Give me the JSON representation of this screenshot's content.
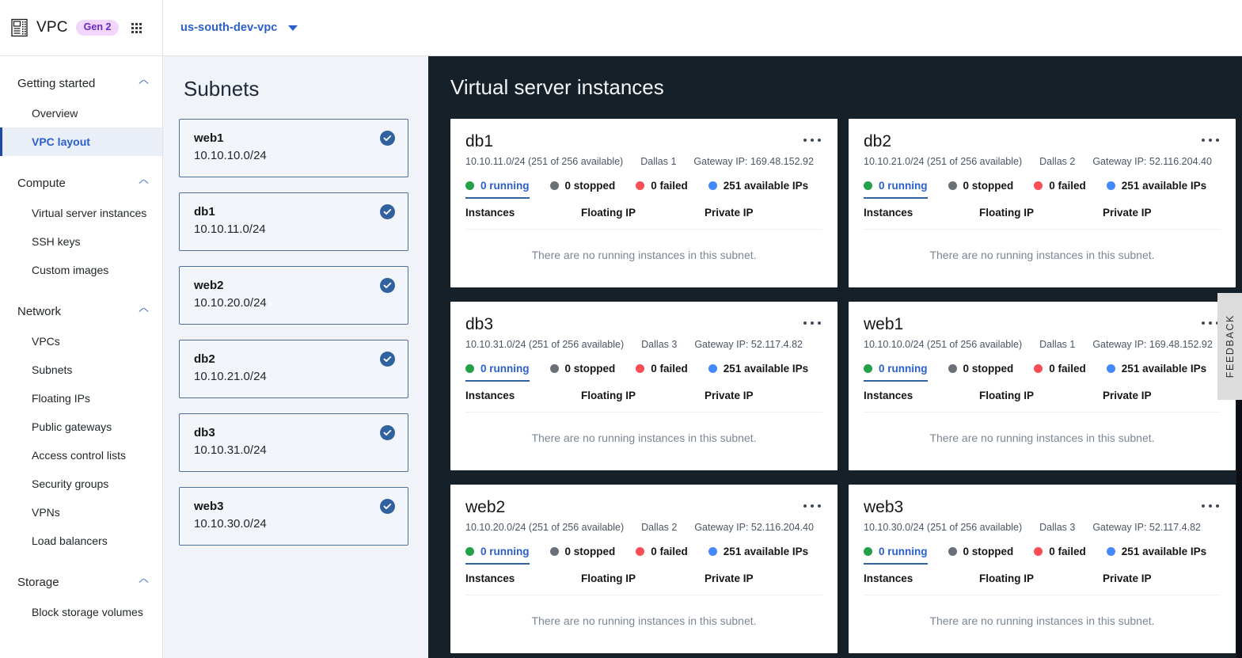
{
  "header": {
    "logo_icon": "server-rack-icon",
    "brand": "VPC",
    "gen_badge": "Gen 2",
    "app_switcher_icon": "grid-dots-icon",
    "vpc_selector": {
      "value": "us-south-dev-vpc",
      "caret_icon": "chevron-down-icon"
    }
  },
  "sidebar": {
    "groups": [
      {
        "title": "Getting started",
        "chevron_icon": "chevron-up-icon",
        "items": [
          {
            "label": "Overview",
            "active": false
          },
          {
            "label": "VPC layout",
            "active": true
          }
        ]
      },
      {
        "title": "Compute",
        "chevron_icon": "chevron-up-icon",
        "items": [
          {
            "label": "Virtual server instances",
            "active": false
          },
          {
            "label": "SSH keys",
            "active": false
          },
          {
            "label": "Custom images",
            "active": false
          }
        ]
      },
      {
        "title": "Network",
        "chevron_icon": "chevron-up-icon",
        "items": [
          {
            "label": "VPCs",
            "active": false
          },
          {
            "label": "Subnets",
            "active": false
          },
          {
            "label": "Floating IPs",
            "active": false
          },
          {
            "label": "Public gateways",
            "active": false
          },
          {
            "label": "Access control lists",
            "active": false
          },
          {
            "label": "Security groups",
            "active": false
          },
          {
            "label": "VPNs",
            "active": false
          },
          {
            "label": "Load balancers",
            "active": false
          }
        ]
      },
      {
        "title": "Storage",
        "chevron_icon": "chevron-up-icon",
        "items": [
          {
            "label": "Block storage volumes",
            "active": false
          }
        ]
      }
    ]
  },
  "subnets_panel": {
    "title": "Subnets",
    "check_icon": "check-circle-icon",
    "items": [
      {
        "name": "web1",
        "cidr": "10.10.10.0/24",
        "selected": true
      },
      {
        "name": "db1",
        "cidr": "10.10.11.0/24",
        "selected": true
      },
      {
        "name": "web2",
        "cidr": "10.10.20.0/24",
        "selected": true
      },
      {
        "name": "db2",
        "cidr": "10.10.21.0/24",
        "selected": true
      },
      {
        "name": "db3",
        "cidr": "10.10.31.0/24",
        "selected": true
      },
      {
        "name": "web3",
        "cidr": "10.10.30.0/24",
        "selected": true
      }
    ]
  },
  "instances_panel": {
    "title": "Virtual server instances",
    "kebab_icon": "overflow-menu-icon",
    "table_headers": [
      "Instances",
      "Floating IP",
      "Private IP"
    ],
    "empty_message": "There are no running instances in this subnet.",
    "status_colors": {
      "running": "#24a148",
      "stopped": "#697077",
      "failed": "#fa4d56",
      "available": "#4589ff",
      "link": "#2b5fce"
    },
    "cards": [
      {
        "name": "db1",
        "cidr": "10.10.11.0/24 (251 of 256 available)",
        "zone": "Dallas 1",
        "gateway": "Gateway IP: 169.48.152.92",
        "stats": [
          {
            "label": "0 running",
            "kind": "running"
          },
          {
            "label": "0 stopped",
            "kind": "stopped"
          },
          {
            "label": "0 failed",
            "kind": "failed"
          },
          {
            "label": "251 available IPs",
            "kind": "available"
          }
        ]
      },
      {
        "name": "db2",
        "cidr": "10.10.21.0/24 (251 of 256 available)",
        "zone": "Dallas 2",
        "gateway": "Gateway IP: 52.116.204.40",
        "stats": [
          {
            "label": "0 running",
            "kind": "running"
          },
          {
            "label": "0 stopped",
            "kind": "stopped"
          },
          {
            "label": "0 failed",
            "kind": "failed"
          },
          {
            "label": "251 available IPs",
            "kind": "available"
          }
        ]
      },
      {
        "name": "db3",
        "cidr": "10.10.31.0/24 (251 of 256 available)",
        "zone": "Dallas 3",
        "gateway": "Gateway IP: 52.117.4.82",
        "stats": [
          {
            "label": "0 running",
            "kind": "running"
          },
          {
            "label": "0 stopped",
            "kind": "stopped"
          },
          {
            "label": "0 failed",
            "kind": "failed"
          },
          {
            "label": "251 available IPs",
            "kind": "available"
          }
        ]
      },
      {
        "name": "web1",
        "cidr": "10.10.10.0/24 (251 of 256 available)",
        "zone": "Dallas 1",
        "gateway": "Gateway IP: 169.48.152.92",
        "stats": [
          {
            "label": "0 running",
            "kind": "running"
          },
          {
            "label": "0 stopped",
            "kind": "stopped"
          },
          {
            "label": "0 failed",
            "kind": "failed"
          },
          {
            "label": "251 available IPs",
            "kind": "available"
          }
        ]
      },
      {
        "name": "web2",
        "cidr": "10.10.20.0/24 (251 of 256 available)",
        "zone": "Dallas 2",
        "gateway": "Gateway IP: 52.116.204.40",
        "stats": [
          {
            "label": "0 running",
            "kind": "running"
          },
          {
            "label": "0 stopped",
            "kind": "stopped"
          },
          {
            "label": "0 failed",
            "kind": "failed"
          },
          {
            "label": "251 available IPs",
            "kind": "available"
          }
        ]
      },
      {
        "name": "web3",
        "cidr": "10.10.30.0/24 (251 of 256 available)",
        "zone": "Dallas 3",
        "gateway": "Gateway IP: 52.117.4.82",
        "stats": [
          {
            "label": "0 running",
            "kind": "running"
          },
          {
            "label": "0 stopped",
            "kind": "stopped"
          },
          {
            "label": "0 failed",
            "kind": "failed"
          },
          {
            "label": "251 available IPs",
            "kind": "available"
          }
        ]
      }
    ]
  },
  "feedback": {
    "label": "FEEDBACK"
  }
}
